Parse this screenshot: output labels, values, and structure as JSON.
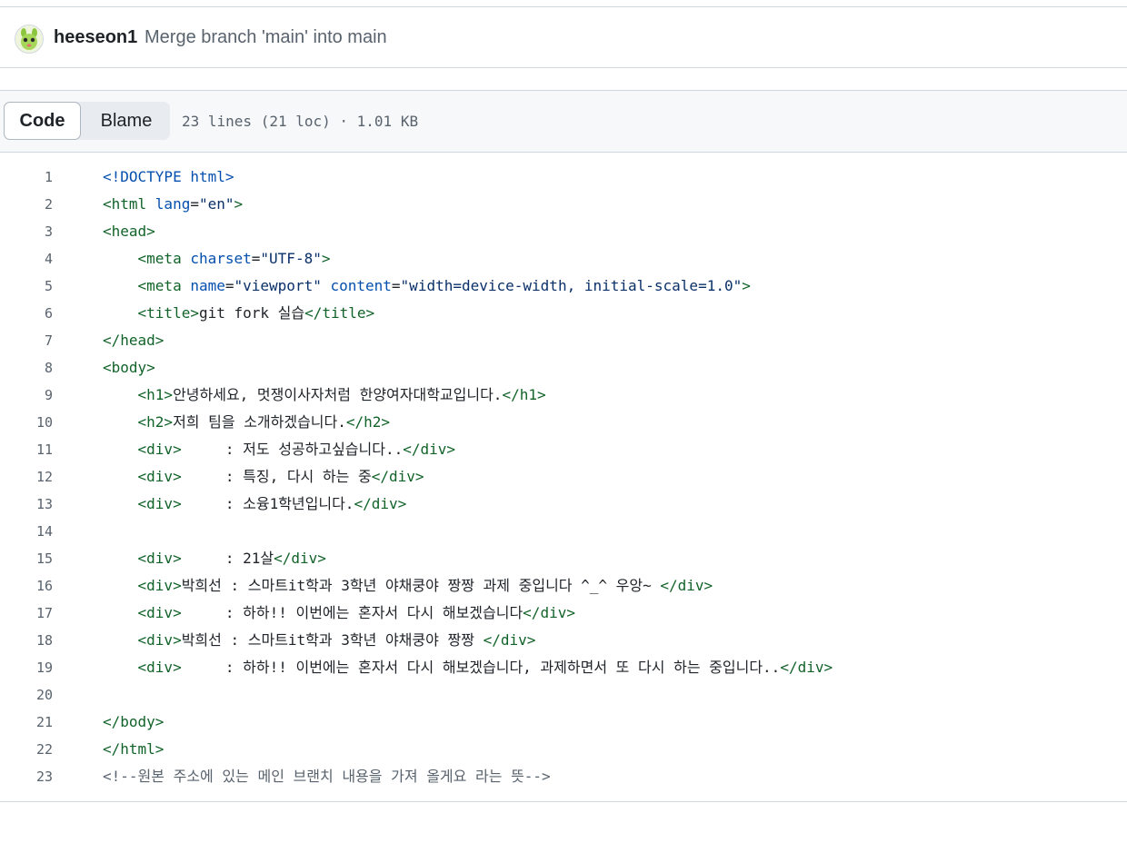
{
  "commit": {
    "author": "heeseon1",
    "message": "Merge branch 'main' into main"
  },
  "file_header": {
    "code_tab": "Code",
    "blame_tab": "Blame",
    "info": "23 lines (21 loc) · 1.01 KB"
  },
  "code_lines": [
    {
      "n": "1",
      "segs": [
        {
          "t": "<!DOCTYPE html>",
          "c": "doctype"
        }
      ]
    },
    {
      "n": "2",
      "segs": [
        {
          "t": "<html ",
          "c": "tag"
        },
        {
          "t": "lang",
          "c": "attr"
        },
        {
          "t": "=",
          "c": "plain"
        },
        {
          "t": "\"en\"",
          "c": "str"
        },
        {
          "t": ">",
          "c": "tag"
        }
      ]
    },
    {
      "n": "3",
      "segs": [
        {
          "t": "<head>",
          "c": "tag"
        }
      ]
    },
    {
      "n": "4",
      "segs": [
        {
          "t": "    ",
          "c": "plain"
        },
        {
          "t": "<meta ",
          "c": "tag"
        },
        {
          "t": "charset",
          "c": "attr"
        },
        {
          "t": "=",
          "c": "plain"
        },
        {
          "t": "\"UTF-8\"",
          "c": "str"
        },
        {
          "t": ">",
          "c": "tag"
        }
      ]
    },
    {
      "n": "5",
      "segs": [
        {
          "t": "    ",
          "c": "plain"
        },
        {
          "t": "<meta ",
          "c": "tag"
        },
        {
          "t": "name",
          "c": "attr"
        },
        {
          "t": "=",
          "c": "plain"
        },
        {
          "t": "\"viewport\"",
          "c": "str"
        },
        {
          "t": " ",
          "c": "plain"
        },
        {
          "t": "content",
          "c": "attr"
        },
        {
          "t": "=",
          "c": "plain"
        },
        {
          "t": "\"width=device-width, initial-scale=1.0\"",
          "c": "str"
        },
        {
          "t": ">",
          "c": "tag"
        }
      ]
    },
    {
      "n": "6",
      "segs": [
        {
          "t": "    ",
          "c": "plain"
        },
        {
          "t": "<title>",
          "c": "tag"
        },
        {
          "t": "git fork 실습",
          "c": "plain"
        },
        {
          "t": "</title>",
          "c": "tag"
        }
      ]
    },
    {
      "n": "7",
      "segs": [
        {
          "t": "</head>",
          "c": "tag"
        }
      ]
    },
    {
      "n": "8",
      "segs": [
        {
          "t": "<body>",
          "c": "tag"
        }
      ]
    },
    {
      "n": "9",
      "segs": [
        {
          "t": "    ",
          "c": "plain"
        },
        {
          "t": "<h1>",
          "c": "tag"
        },
        {
          "t": "안녕하세요, 멋쟁이사자처럼 한양여자대학교입니다.",
          "c": "plain"
        },
        {
          "t": "</h1>",
          "c": "tag"
        }
      ]
    },
    {
      "n": "10",
      "segs": [
        {
          "t": "    ",
          "c": "plain"
        },
        {
          "t": "<h2>",
          "c": "tag"
        },
        {
          "t": "저희 팀을 소개하겠습니다.",
          "c": "plain"
        },
        {
          "t": "</h2>",
          "c": "tag"
        }
      ]
    },
    {
      "n": "11",
      "segs": [
        {
          "t": "    ",
          "c": "plain"
        },
        {
          "t": "<div>",
          "c": "tag"
        },
        {
          "t": "     : 저도 성공하고싶습니다..",
          "c": "plain"
        },
        {
          "t": "</div>",
          "c": "tag"
        }
      ]
    },
    {
      "n": "12",
      "segs": [
        {
          "t": "    ",
          "c": "plain"
        },
        {
          "t": "<div>",
          "c": "tag"
        },
        {
          "t": "     : 특징, 다시 하는 중",
          "c": "plain"
        },
        {
          "t": "</div>",
          "c": "tag"
        }
      ]
    },
    {
      "n": "13",
      "segs": [
        {
          "t": "    ",
          "c": "plain"
        },
        {
          "t": "<div>",
          "c": "tag"
        },
        {
          "t": "     : 소융1학년입니다.",
          "c": "plain"
        },
        {
          "t": "</div>",
          "c": "tag"
        }
      ]
    },
    {
      "n": "14",
      "segs": []
    },
    {
      "n": "15",
      "segs": [
        {
          "t": "    ",
          "c": "plain"
        },
        {
          "t": "<div>",
          "c": "tag"
        },
        {
          "t": "     : 21살",
          "c": "plain"
        },
        {
          "t": "</div>",
          "c": "tag"
        }
      ]
    },
    {
      "n": "16",
      "segs": [
        {
          "t": "    ",
          "c": "plain"
        },
        {
          "t": "<div>",
          "c": "tag"
        },
        {
          "t": "박희선 : 스마트it학과 3학년 야채쿵야 짱짱 과제 중입니다 ^_^ 우앙~ ",
          "c": "plain"
        },
        {
          "t": "</div>",
          "c": "tag"
        }
      ]
    },
    {
      "n": "17",
      "segs": [
        {
          "t": "    ",
          "c": "plain"
        },
        {
          "t": "<div>",
          "c": "tag"
        },
        {
          "t": "     : 하하!! 이번에는 혼자서 다시 해보겠습니다",
          "c": "plain"
        },
        {
          "t": "</div>",
          "c": "tag"
        }
      ]
    },
    {
      "n": "18",
      "segs": [
        {
          "t": "    ",
          "c": "plain"
        },
        {
          "t": "<div>",
          "c": "tag"
        },
        {
          "t": "박희선 : 스마트it학과 3학년 야채쿵야 짱짱 ",
          "c": "plain"
        },
        {
          "t": "</div>",
          "c": "tag"
        }
      ]
    },
    {
      "n": "19",
      "segs": [
        {
          "t": "    ",
          "c": "plain"
        },
        {
          "t": "<div>",
          "c": "tag"
        },
        {
          "t": "     : 하하!! 이번에는 혼자서 다시 해보겠습니다, 과제하면서 또 다시 하는 중입니다..",
          "c": "plain"
        },
        {
          "t": "</div>",
          "c": "tag"
        }
      ]
    },
    {
      "n": "20",
      "segs": []
    },
    {
      "n": "21",
      "segs": [
        {
          "t": "</body>",
          "c": "tag"
        }
      ]
    },
    {
      "n": "22",
      "segs": [
        {
          "t": "</html>",
          "c": "tag"
        }
      ]
    },
    {
      "n": "23",
      "segs": [
        {
          "t": "<!--원본 주소에 있는 메인 브랜치 내용을 가져 올게요 라는 뜻-->",
          "c": "cmt"
        }
      ]
    }
  ]
}
